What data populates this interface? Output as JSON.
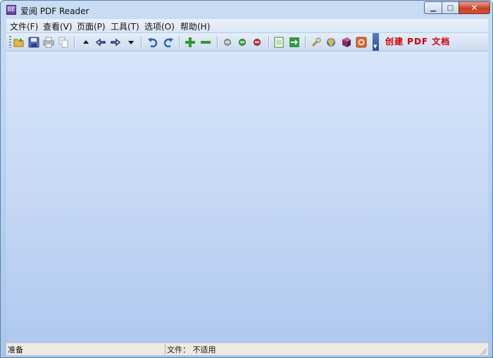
{
  "window": {
    "title": "爱阅 PDF Reader",
    "icon_text": "BE"
  },
  "window_controls": {
    "minimize": "▁",
    "maximize": "□",
    "close": "✕"
  },
  "menu": [
    {
      "label": "文件(F)"
    },
    {
      "label": "查看(V)"
    },
    {
      "label": "页面(P)"
    },
    {
      "label": "工具(T)"
    },
    {
      "label": "选项(O)"
    },
    {
      "label": "帮助(H)"
    }
  ],
  "toolbar": {
    "icons": [
      "open-folder-icon",
      "save-icon",
      "print-icon",
      "copy-icon",
      "page-up-icon",
      "back-icon",
      "forward-icon",
      "page-down-icon",
      "undo-icon",
      "redo-icon",
      "zoom-in-icon",
      "zoom-out-icon",
      "gray-dot-icon",
      "green-dot-icon",
      "red-dot-icon",
      "document-icon",
      "exit-icon",
      "wrench-icon",
      "shield-icon",
      "book-icon",
      "help-icon"
    ],
    "create_pdf_label": "创建 PDF 文档"
  },
  "status": {
    "ready": "准备",
    "file": "文件： 不适用"
  }
}
